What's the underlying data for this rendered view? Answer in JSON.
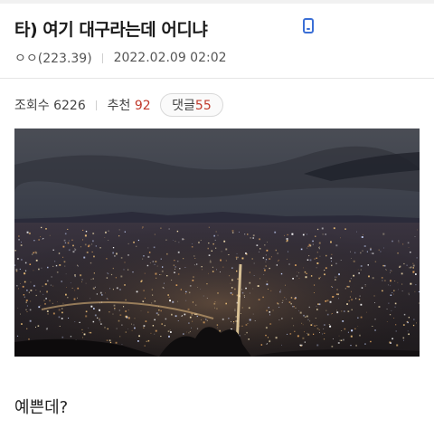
{
  "post": {
    "title": "타) 여기 대구라는데 어디냐",
    "author": "ㅇㅇ(223.39)",
    "datetime": "2022.02.09 02:02",
    "device_icon": "mobile-phone-icon"
  },
  "stats": {
    "views_label": "조회수",
    "views_value": "6226",
    "recommend_label": "추천",
    "recommend_value": "92",
    "comments_label": "댓글",
    "comments_value": "55"
  },
  "content": {
    "body": "예쁜데?"
  },
  "colors": {
    "accent_red": "#c0392b",
    "icon_blue": "#3b6fd6"
  }
}
